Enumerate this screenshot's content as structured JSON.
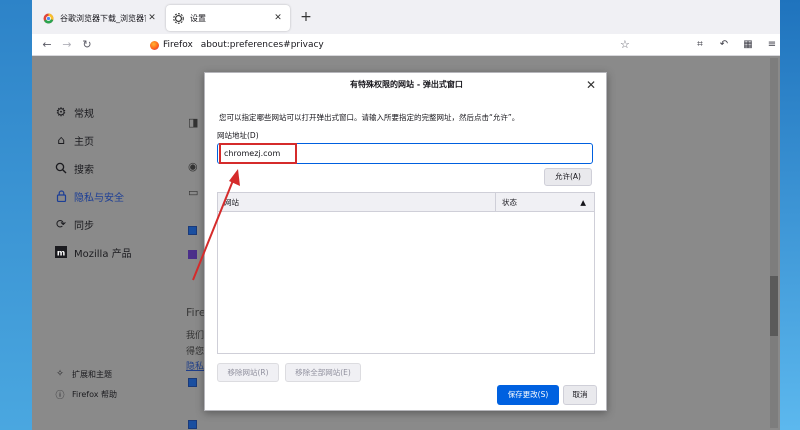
{
  "tabs": [
    {
      "title": "谷歌浏览器下载_浏览器官网入",
      "active": false
    },
    {
      "title": "设置",
      "active": true
    }
  ],
  "nav": {
    "identity_label": "Firefox",
    "url": "about:preferences#privacy"
  },
  "sidebar": {
    "items": [
      {
        "label": "常规",
        "icon": "gear-icon"
      },
      {
        "label": "主页",
        "icon": "home-icon"
      },
      {
        "label": "搜索",
        "icon": "search-icon"
      },
      {
        "label": "隐私与安全",
        "icon": "lock-icon",
        "active": true
      },
      {
        "label": "同步",
        "icon": "sync-icon"
      },
      {
        "label": "Mozilla 产品",
        "icon": "mozilla-icon"
      }
    ],
    "bottom": [
      {
        "label": "扩展和主题",
        "icon": "puzzle-icon"
      },
      {
        "label": "Firefox 帮助",
        "icon": "help-icon"
      }
    ]
  },
  "background": {
    "heading_fragment": "Fire",
    "line1_fragment": "我们",
    "line2_fragment": "得您",
    "link_fragment": "隐私"
  },
  "dialog": {
    "title": "有特殊权限的网站 - 弹出式窗口",
    "description": "您可以指定哪些网站可以打开弹出式窗口。请输入所要指定的完整网址，然后点击“允许”。",
    "address_label": "网站地址(D)",
    "address_value": "chromezj.com",
    "allow_button": "允许(A)",
    "table_headers": {
      "site": "网站",
      "status": "状态"
    },
    "remove_site": "移除网站(R)",
    "remove_all": "移除全部网站(E)",
    "save": "保存更改(S)",
    "cancel": "取消"
  },
  "colors": {
    "accent": "#0061e0",
    "annotation": "#d52b2b"
  }
}
